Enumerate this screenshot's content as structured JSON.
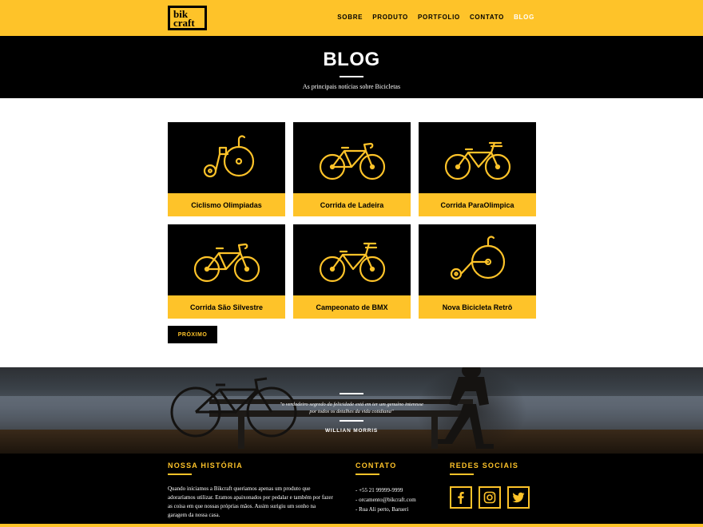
{
  "brand": {
    "logo_line1": "bik",
    "logo_line2": "craft"
  },
  "nav": [
    {
      "label": "SOBRE",
      "active": false
    },
    {
      "label": "PRODUTO",
      "active": false
    },
    {
      "label": "PORTFOLIO",
      "active": false
    },
    {
      "label": "CONTATO",
      "active": false
    },
    {
      "label": "BLOG",
      "active": true
    }
  ],
  "page": {
    "title": "BLOG",
    "subtitle": "As principais notícias sobre Bicicletas"
  },
  "posts": [
    {
      "title": "Ciclismo Olimpiadas",
      "icon": "penny-farthing-icon"
    },
    {
      "title": "Corrida de Ladeira",
      "icon": "road-bike-icon"
    },
    {
      "title": "Corrida ParaOlimpica",
      "icon": "city-bike-icon"
    },
    {
      "title": "Corrida São Silvestre",
      "icon": "road-bike-icon"
    },
    {
      "title": "Campeonato de BMX",
      "icon": "city-bike-icon"
    },
    {
      "title": "Nova Bicicleta Retrô",
      "icon": "penny-farthing-icon"
    }
  ],
  "pagination": {
    "next_label": "PRÓXIMO"
  },
  "quote": {
    "text": "\"o verdadeiro segredo da felicidade está em ter um genuíno interesse por todos os detalhes da vida cotidiana\"",
    "author": "WILLIAN MORRIS"
  },
  "footer": {
    "history": {
      "title": "NOSSA HISTÓRIA",
      "text": "Quando iniciamos a Bikcraft queriamos apenas um produto que adoraríamos utilizar. Eramos apaixonados por pedalar e também por fazer as coisa em que nossas próprias mãos. Assim surigiu um sonho na garagem da nossa casa."
    },
    "contact": {
      "title": "CONTATO",
      "items": [
        "- +55 21 99999-9999",
        "- orcamento@bikcraft.com",
        "- Rua Ali perto, Barueri"
      ]
    },
    "social": {
      "title": "REDES SOCIAIS",
      "items": [
        {
          "icon": "facebook-icon"
        },
        {
          "icon": "instagram-icon"
        },
        {
          "icon": "twitter-icon"
        }
      ]
    }
  },
  "colors": {
    "accent": "#FEC329",
    "dark": "#000000",
    "light": "#FFFFFF"
  }
}
